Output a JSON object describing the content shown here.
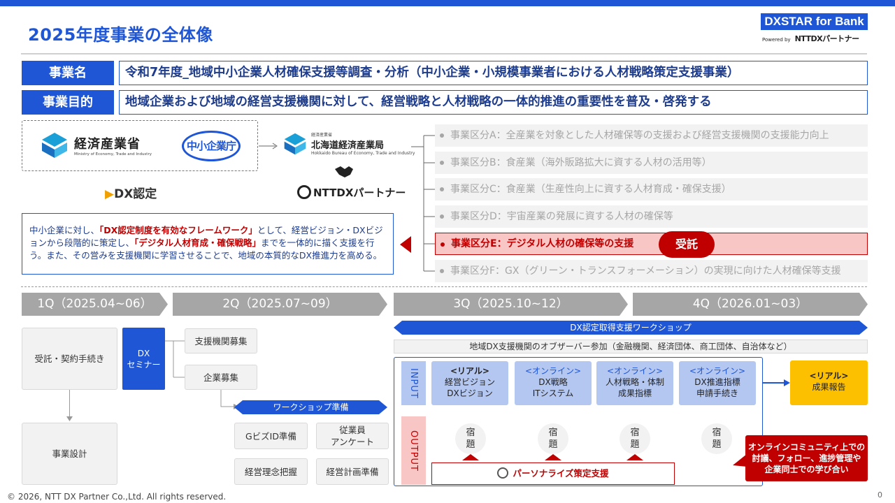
{
  "header": {
    "title": "2025年度事業の全体像",
    "brand": "DXSTAR for Bank",
    "brand_powered": "Powered by",
    "brand_company": "NTTDXパートナー"
  },
  "project": {
    "name_label": "事業名",
    "name_value": "令和7年度_地域中小企業人材確保支援等調査・分析（中小企業・小規模事業者における人材戦略策定支援事業）",
    "purpose_label": "事業目的",
    "purpose_value": "地域企業および地域の経営支援機関に対して、経営戦略と人材戦略の一体的推進の重要性を普及・啓発する"
  },
  "orgs": {
    "meti": "経済産業省",
    "meti_en": "Ministry of Economy, Trade and Industry",
    "chusho": "中小企業庁",
    "hokkaido_small": "経済産業省",
    "hokkaido": "北海道経済産業局",
    "hokkaido_en": "Hokkaido Bureau of Economy, Trade and Industry",
    "dx_nintei": "DX認定",
    "ntt": "NTTDXパートナー"
  },
  "bubble": {
    "t1": "中小企業に対し、",
    "r1": "「DX認定制度を有効なフレームワーク」",
    "t2": "として、経営ビジョン・DXビジョンから段階的に策定し、",
    "r2": "「デジタル人材育成・確保戦略」",
    "t3": "までを一体的に描く支援を行う。また、その営みを支援機関に学習させることで、地域の本質的なDX推進力を高める。"
  },
  "categories": [
    "事業区分A：全産業を対象とした人材確保等の支援および経営支援機関の支援能力向上",
    "事業区分B：食産業（海外販路拡大に資する人材の活用等）",
    "事業区分C：食産業（生産性向上に資する人材育成・確保支援）",
    "事業区分D：宇宙産業の発展に資する人材の確保等",
    "事業区分E：デジタル人材の確保等の支援",
    "事業区分F：GX（グリーン・トランスフォーメーション）の実現に向けた人材確保等支援"
  ],
  "award_badge": "受託",
  "quarters": [
    "1Q（2025.04~06）",
    "2Q（2025.07~09）",
    "3Q（2025.10~12）",
    "4Q（2026.01~03）"
  ],
  "timeline": {
    "contract": "受託・契約手続き",
    "design": "事業設計",
    "dx_seminar": "DX\nセミナー",
    "recruit_agency": "支援機関募集",
    "recruit_company": "企業募集",
    "ws_prep": "ワークショップ準備",
    "gbiz": "GビズID準備",
    "survey": "従業員\nアンケート",
    "philosophy": "経営理念把握",
    "plan": "経営計画準備",
    "workshop": "DX認定取得支援ワークショップ",
    "observer": "地域DX支援機関のオブザーバー参加（金融機関、経済団体、商工団体、自治体など）",
    "input": "INPUT",
    "output": "OUTPUT",
    "cards": [
      {
        "tag": "<リアル>",
        "l1": "経営ビジョン",
        "l2": "DXビジョン"
      },
      {
        "tag": "<オンライン>",
        "l1": "DX戦略",
        "l2": "ITシステム"
      },
      {
        "tag": "<オンライン>",
        "l1": "人材戦略・体制",
        "l2": "成果指標"
      },
      {
        "tag": "<オンライン>",
        "l1": "DX推進指標",
        "l2": "申請手続き"
      }
    ],
    "homework": "宿\n題",
    "personalize": "パーソナライズ策定支援",
    "report_tag": "<リアル>",
    "report": "成果報告",
    "community": "オンラインコミュニティ上での\n討議、フォロー、進捗管理や\n企業同士での学び合い"
  },
  "footer": {
    "copyright": "© 2026, NTT DX Partner Co.,Ltd.  All rights reserved.",
    "page": "0"
  },
  "colors": {
    "primary": "#1e56d6",
    "accent": "#c00000",
    "gray": "#a6a6a6",
    "yellow": "#fcc000"
  }
}
